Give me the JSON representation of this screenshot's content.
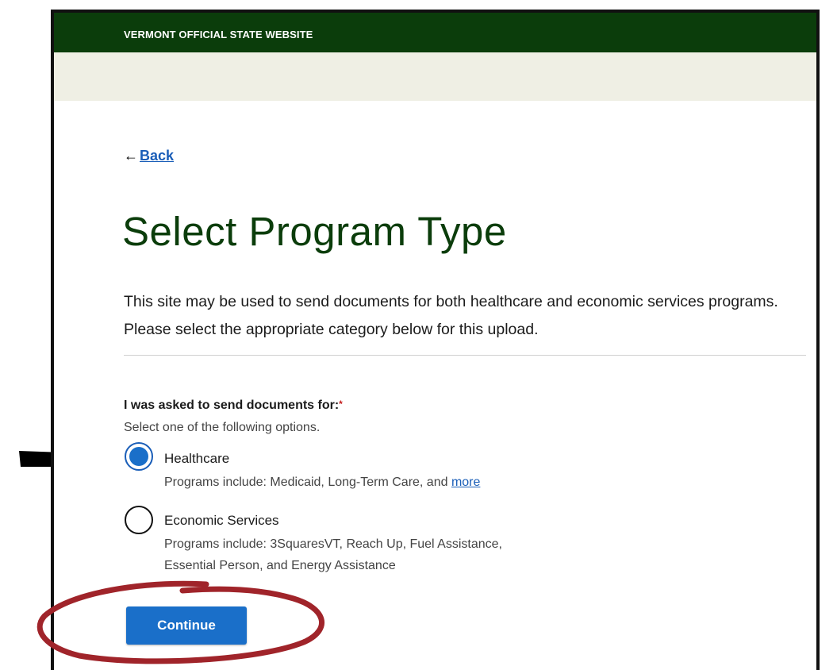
{
  "header": {
    "banner_text": "VERMONT OFFICIAL STATE WEBSITE"
  },
  "nav": {
    "back_label": "Back"
  },
  "page": {
    "title": "Select Program Type",
    "intro": "This site may be used to send documents for both healthcare and economic services programs. Please select the appropriate category below for this upload."
  },
  "form": {
    "question": "I was asked to send documents for:",
    "required_marker": "*",
    "hint": "Select one of the following options.",
    "options": [
      {
        "label": "Healthcare",
        "selected": true,
        "description": "Programs include: Medicaid, Long-Term Care, and ",
        "link_text": "more"
      },
      {
        "label": "Economic Services",
        "selected": false,
        "description_line1": "Programs include: 3SquaresVT, Reach Up, Fuel Assistance,",
        "description_line2": "Essential Person, and Energy Assistance"
      }
    ],
    "continue_label": "Continue"
  },
  "colors": {
    "header_green": "#0b3d0b",
    "subbar": "#efefe4",
    "primary_blue": "#1a6fc9",
    "link_blue": "#1a5eb8",
    "annotation_red": "#a0242a"
  },
  "icons": {
    "back": "left-arrow-icon",
    "annotation_pointer": "black-pointer-arrow-icon",
    "annotation_circle": "red-hand-drawn-circle"
  }
}
